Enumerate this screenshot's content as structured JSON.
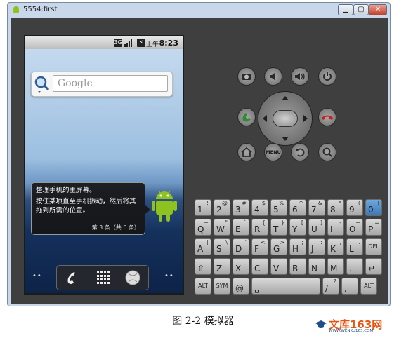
{
  "window": {
    "title": "5554:first",
    "buttons": {
      "minimize": "▁",
      "maximize": "▢",
      "close": "✕"
    }
  },
  "status_bar": {
    "network_label": "3G",
    "ampm": "上午",
    "time": "8:23"
  },
  "home": {
    "search_placeholder": "Google",
    "tooltip": {
      "title": "整理手机的主屏幕。",
      "body": "按住某项直至手机振动，然后将其拖到所需的位置。",
      "count": "第 3 条（共 6 条）"
    },
    "pager_left": "••",
    "pager_right": "••"
  },
  "hardware": {
    "menu_label": "MENU"
  },
  "keyboard": {
    "rows": [
      [
        {
          "m": "1",
          "s": "!"
        },
        {
          "m": "2",
          "s": "@"
        },
        {
          "m": "3",
          "s": "#"
        },
        {
          "m": "4",
          "s": "$"
        },
        {
          "m": "5",
          "s": "%"
        },
        {
          "m": "6",
          "s": "^"
        },
        {
          "m": "7",
          "s": "&"
        },
        {
          "m": "8",
          "s": "*"
        },
        {
          "m": "9",
          "s": "("
        },
        {
          "m": "0",
          "s": ")"
        }
      ],
      [
        {
          "m": "Q",
          "s": "~"
        },
        {
          "m": "W",
          "s": "\""
        },
        {
          "m": "E",
          "s": "`"
        },
        {
          "m": "R",
          "s": "{"
        },
        {
          "m": "T",
          "s": "}"
        },
        {
          "m": "Y",
          "s": "["
        },
        {
          "m": "U",
          "s": "]"
        },
        {
          "m": "I",
          "s": "-"
        },
        {
          "m": "O",
          "s": "+"
        },
        {
          "m": "P",
          "s": "="
        }
      ],
      [
        {
          "m": "A",
          "s": "|"
        },
        {
          "m": "S",
          "s": "\\"
        },
        {
          "m": "D",
          "s": "'"
        },
        {
          "m": "F",
          "s": "<"
        },
        {
          "m": "G",
          "s": ">"
        },
        {
          "m": "H",
          "s": ";"
        },
        {
          "m": "J",
          "s": ":"
        },
        {
          "m": "K",
          "s": ","
        },
        {
          "m": "L",
          "s": "."
        },
        {
          "m": "DEL",
          "s": ""
        }
      ],
      [
        {
          "m": "⇧",
          "s": ""
        },
        {
          "m": "Z",
          "s": ""
        },
        {
          "m": "X",
          "s": ""
        },
        {
          "m": "C",
          "s": ""
        },
        {
          "m": "V",
          "s": ""
        },
        {
          "m": "B",
          "s": ""
        },
        {
          "m": "N",
          "s": ""
        },
        {
          "m": "M",
          "s": ""
        },
        {
          "m": ".",
          "s": ""
        },
        {
          "m": "↵",
          "s": ""
        }
      ],
      [
        {
          "m": "ALT",
          "s": ""
        },
        {
          "m": "SYM",
          "s": ""
        },
        {
          "m": "@",
          "s": ""
        },
        {
          "m": "␣",
          "s": ""
        },
        {
          "m": "/",
          "s": "?"
        },
        {
          "m": ",",
          "s": ""
        },
        {
          "m": "ALT",
          "s": ""
        }
      ]
    ]
  },
  "caption": "图 2-2  模拟器",
  "watermark": {
    "text": "文库163网",
    "url": "WWW.WENKU163.COM",
    "accent": "#e8540f"
  }
}
